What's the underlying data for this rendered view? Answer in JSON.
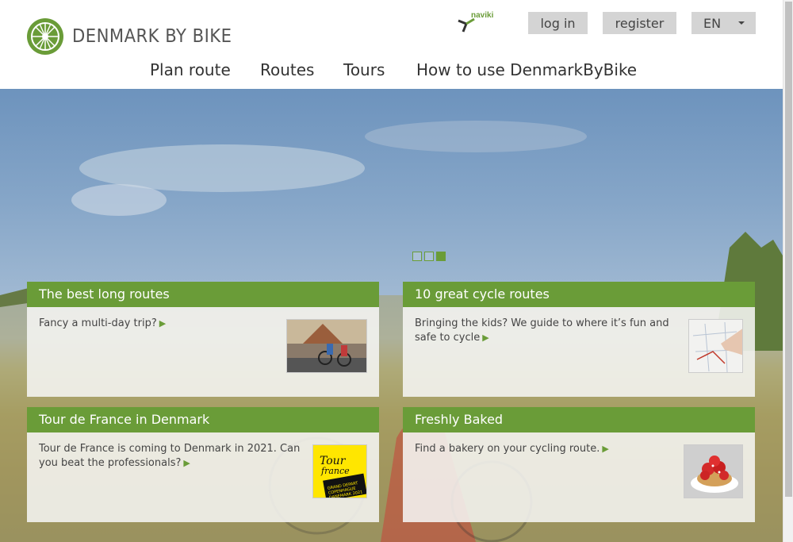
{
  "header": {
    "logo_text": "DENMARK BY BIKE",
    "partner_logo_text": "naviki",
    "login_label": "log in",
    "register_label": "register",
    "language_value": "EN"
  },
  "nav": {
    "items": [
      "Plan route",
      "Routes",
      "Tours",
      "How to use DenmarkByBike"
    ]
  },
  "carousel": {
    "slide_count": 3,
    "active_slide": 3
  },
  "cards": [
    {
      "title": "The best long routes",
      "text": "Fancy a multi-day trip?",
      "image": "family-cyclists-photo"
    },
    {
      "title": "10 great cycle routes",
      "text_line1": "Bringing the kids? We guide to where it’s fun and",
      "text_line2": "safe to cycle",
      "image": "map-planning-photo"
    },
    {
      "title": "Tour de France in Denmark",
      "text_line1": "Tour de France is coming to Denmark in 2021. Can",
      "text_line2": "you beat the professionals?",
      "image": "tour-de-france-logo"
    },
    {
      "title": "Freshly Baked",
      "text": "Find a bakery on your cycling route.",
      "image": "strawberry-tart-photo"
    }
  ],
  "colors": {
    "brand_green": "#6a9c38",
    "button_gray": "#d4d4d4"
  },
  "tdf_logo_text": "TOUR DE FRANCE GRAND DEPART COPENHAGUE DANEMARK 2021"
}
